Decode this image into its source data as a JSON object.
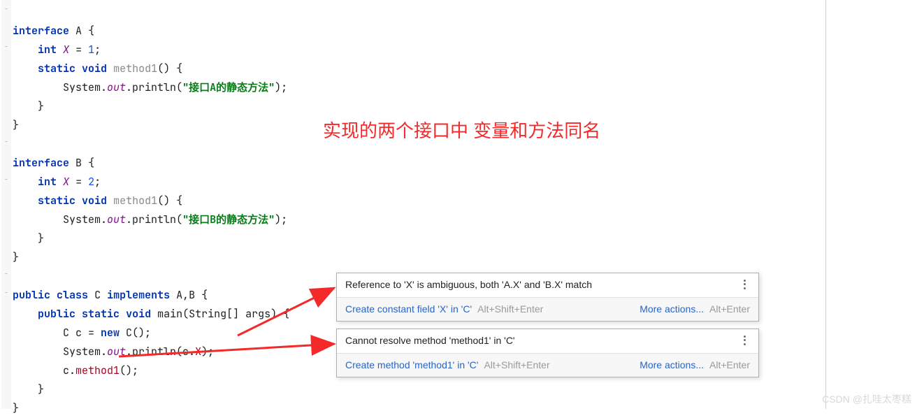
{
  "annotation": "实现的两个接口中 变量和方法同名",
  "code": {
    "intA": {
      "kw1": "interface",
      "name": "A",
      "brace": "{"
    },
    "xA": {
      "kw": "int",
      "name": "X",
      "eq": " = ",
      "val": "1",
      "semi": ";"
    },
    "m1A_head": {
      "kw1": "static",
      "kw2": "void",
      "name": "method1",
      "paren": "() {"
    },
    "m1A_body": {
      "lead": "System.",
      "out": "out",
      "tail": ".println(",
      "str": "\"接口A的静态方法\"",
      "end": ");"
    },
    "closeBrace": "}",
    "intB": {
      "kw1": "interface",
      "name": "B",
      "brace": "{"
    },
    "xB": {
      "kw": "int",
      "name": "X",
      "eq": " = ",
      "val": "2",
      "semi": ";"
    },
    "m1B_head": {
      "kw1": "static",
      "kw2": "void",
      "name": "method1",
      "paren": "() {"
    },
    "m1B_body": {
      "lead": "System.",
      "out": "out",
      "tail": ".println(",
      "str": "\"接口B的静态方法\"",
      "end": ");"
    },
    "classC": {
      "kw1": "public",
      "kw2": "class",
      "name": "C",
      "kw3": "implements",
      "ifaces": "A,B {"
    },
    "main": {
      "kw1": "public",
      "kw2": "static",
      "kw3": "void",
      "name": "main",
      "args": "(String[] args) {"
    },
    "line_new": {
      "lhs": "C c = ",
      "kw": "new",
      "rhs": " C();"
    },
    "line_printX": {
      "lead": "System.",
      "out": "out",
      "tail": ".println(c.",
      "x": "X",
      "end": ");"
    },
    "line_m1": {
      "obj": "c.",
      "m": "method1",
      "end": "();"
    }
  },
  "tooltip1": {
    "message": "Reference to 'X' is ambiguous, both 'A.X' and 'B.X' match",
    "fix": "Create constant field 'X' in 'C'",
    "shortcut1": "Alt+Shift+Enter",
    "more": "More actions...",
    "shortcut2": "Alt+Enter"
  },
  "tooltip2": {
    "message": "Cannot resolve method 'method1' in 'C'",
    "fix": "Create method 'method1' in 'C'",
    "shortcut1": "Alt+Shift+Enter",
    "more": "More actions...",
    "shortcut2": "Alt+Enter"
  },
  "watermark": "CSDN @扎哇太枣糕"
}
